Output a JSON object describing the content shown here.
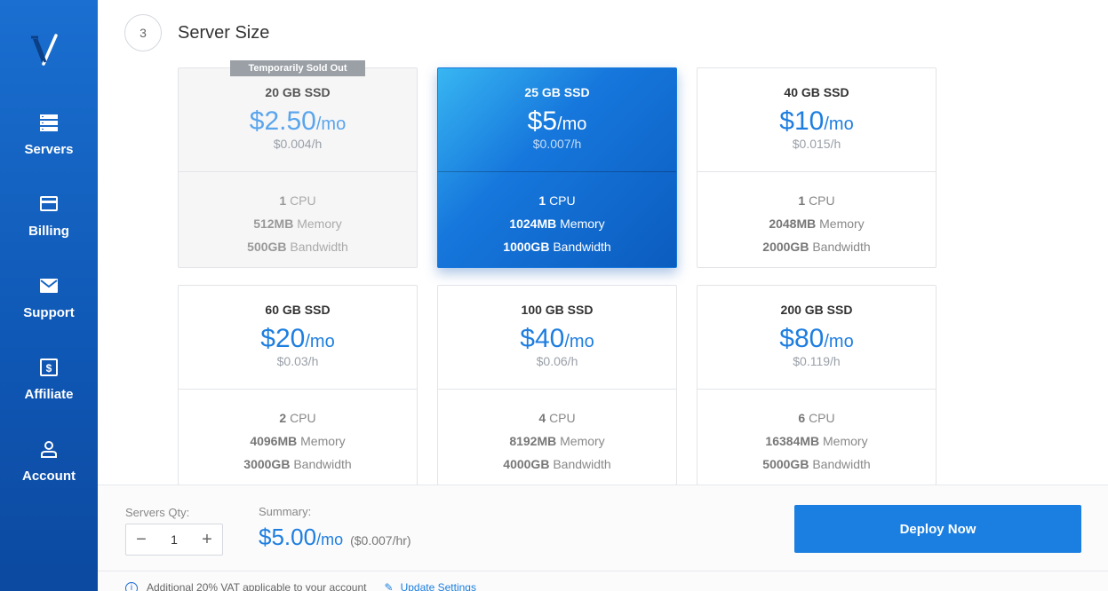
{
  "sidebar": {
    "items": [
      {
        "label": "Servers",
        "icon": "servers-icon"
      },
      {
        "label": "Billing",
        "icon": "credit-card-icon"
      },
      {
        "label": "Support",
        "icon": "envelope-icon"
      },
      {
        "label": "Affiliate",
        "icon": "dollar-bill-icon"
      },
      {
        "label": "Account",
        "icon": "user-icon"
      }
    ]
  },
  "section": {
    "step_number": "3",
    "title": "Server Size"
  },
  "plans": [
    {
      "size": "20 GB SSD",
      "price": "$2.50",
      "per": "/mo",
      "hourly": "$0.004/h",
      "cpu_value": "1",
      "cpu_unit": "CPU",
      "memory_value": "512MB",
      "memory_unit": "Memory",
      "bandwidth_value": "500GB",
      "bandwidth_unit": "Bandwidth",
      "tag": "Temporarily Sold Out",
      "state": "soldout"
    },
    {
      "size": "25 GB SSD",
      "price": "$5",
      "per": "/mo",
      "hourly": "$0.007/h",
      "cpu_value": "1",
      "cpu_unit": "CPU",
      "memory_value": "1024MB",
      "memory_unit": "Memory",
      "bandwidth_value": "1000GB",
      "bandwidth_unit": "Bandwidth",
      "state": "selected"
    },
    {
      "size": "40 GB SSD",
      "price": "$10",
      "per": "/mo",
      "hourly": "$0.015/h",
      "cpu_value": "1",
      "cpu_unit": "CPU",
      "memory_value": "2048MB",
      "memory_unit": "Memory",
      "bandwidth_value": "2000GB",
      "bandwidth_unit": "Bandwidth",
      "state": "available"
    },
    {
      "size": "60 GB SSD",
      "price": "$20",
      "per": "/mo",
      "hourly": "$0.03/h",
      "cpu_value": "2",
      "cpu_unit": "CPU",
      "memory_value": "4096MB",
      "memory_unit": "Memory",
      "bandwidth_value": "3000GB",
      "bandwidth_unit": "Bandwidth",
      "state": "available"
    },
    {
      "size": "100 GB SSD",
      "price": "$40",
      "per": "/mo",
      "hourly": "$0.06/h",
      "cpu_value": "4",
      "cpu_unit": "CPU",
      "memory_value": "8192MB",
      "memory_unit": "Memory",
      "bandwidth_value": "4000GB",
      "bandwidth_unit": "Bandwidth",
      "state": "available"
    },
    {
      "size": "200 GB SSD",
      "price": "$80",
      "per": "/mo",
      "hourly": "$0.119/h",
      "cpu_value": "6",
      "cpu_unit": "CPU",
      "memory_value": "16384MB",
      "memory_unit": "Memory",
      "bandwidth_value": "5000GB",
      "bandwidth_unit": "Bandwidth",
      "state": "available"
    }
  ],
  "footer": {
    "qty_label": "Servers Qty:",
    "qty_value": "1",
    "minus": "−",
    "plus": "+",
    "summary_label": "Summary:",
    "summary_price": "$5.00",
    "summary_per": "/mo",
    "summary_hourly": "($0.007/hr)",
    "deploy_label": "Deploy Now",
    "vat_text": "Additional 20% VAT applicable to your account",
    "update_link": "Update Settings"
  },
  "colors": {
    "sidebar": "#1464c4",
    "accent": "#1e7ee0",
    "selected_card": "#1677dc"
  }
}
